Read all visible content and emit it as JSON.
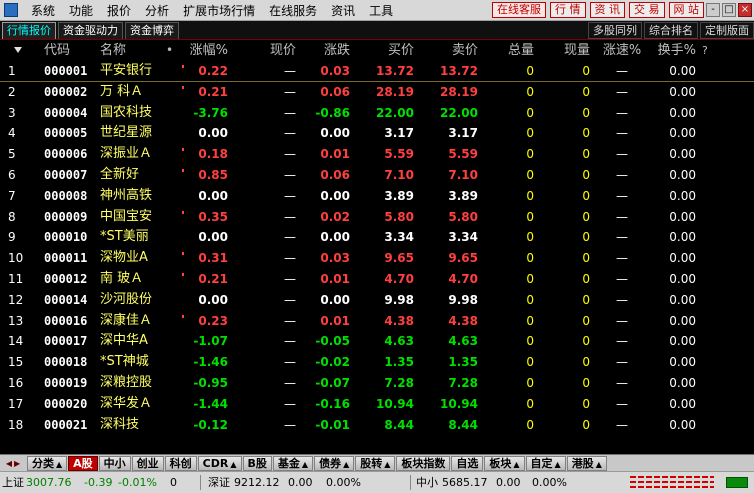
{
  "menu": {
    "items": [
      "系统",
      "功能",
      "报价",
      "分析",
      "扩展市场行情",
      "在线服务",
      "资讯",
      "工具"
    ],
    "buttons": [
      "在线客服",
      "行 情",
      "资 讯",
      "交 易",
      "网 站"
    ],
    "window_controls": [
      "-",
      "□",
      "×"
    ]
  },
  "subtabs": {
    "left": [
      "行情报价",
      "资金驱动力",
      "资金博弈"
    ],
    "right": [
      "多股同列",
      "综合排名",
      "定制版面"
    ]
  },
  "table": {
    "headers": {
      "code": "代码",
      "name": "名称",
      "dot": "•",
      "chg_pct": "涨幅%",
      "price": "现价",
      "diff": "涨跌",
      "buy": "买价",
      "sell": "卖价",
      "volume": "总量",
      "cur_vol": "现量",
      "speed": "涨速%",
      "turnover": "换手%",
      "help": "?"
    },
    "rows": [
      {
        "idx": "1",
        "code": "000001",
        "name": "平安银行",
        "chg": "0.22",
        "price": "—",
        "diff": "0.03",
        "buy": "13.72",
        "sell": "13.72",
        "vol": "0",
        "cur": "0",
        "spd": "—",
        "turn": "0.00",
        "dir": "up"
      },
      {
        "idx": "2",
        "code": "000002",
        "name": "万 科Ａ",
        "chg": "0.21",
        "price": "—",
        "diff": "0.06",
        "buy": "28.19",
        "sell": "28.19",
        "vol": "0",
        "cur": "0",
        "spd": "—",
        "turn": "0.00",
        "dir": "up"
      },
      {
        "idx": "3",
        "code": "000004",
        "name": "国农科技",
        "chg": "-3.76",
        "price": "—",
        "diff": "-0.86",
        "buy": "22.00",
        "sell": "22.00",
        "vol": "0",
        "cur": "0",
        "spd": "—",
        "turn": "0.00",
        "dir": "down"
      },
      {
        "idx": "4",
        "code": "000005",
        "name": "世纪星源",
        "chg": "0.00",
        "price": "—",
        "diff": "0.00",
        "buy": "3.17",
        "sell": "3.17",
        "vol": "0",
        "cur": "0",
        "spd": "—",
        "turn": "0.00",
        "dir": "flat"
      },
      {
        "idx": "5",
        "code": "000006",
        "name": "深振业Ａ",
        "chg": "0.18",
        "price": "—",
        "diff": "0.01",
        "buy": "5.59",
        "sell": "5.59",
        "vol": "0",
        "cur": "0",
        "spd": "—",
        "turn": "0.00",
        "dir": "up"
      },
      {
        "idx": "6",
        "code": "000007",
        "name": "全新好",
        "chg": "0.85",
        "price": "—",
        "diff": "0.06",
        "buy": "7.10",
        "sell": "7.10",
        "vol": "0",
        "cur": "0",
        "spd": "—",
        "turn": "0.00",
        "dir": "up"
      },
      {
        "idx": "7",
        "code": "000008",
        "name": "神州高铁",
        "chg": "0.00",
        "price": "—",
        "diff": "0.00",
        "buy": "3.89",
        "sell": "3.89",
        "vol": "0",
        "cur": "0",
        "spd": "—",
        "turn": "0.00",
        "dir": "flat"
      },
      {
        "idx": "8",
        "code": "000009",
        "name": "中国宝安",
        "chg": "0.35",
        "price": "—",
        "diff": "0.02",
        "buy": "5.80",
        "sell": "5.80",
        "vol": "0",
        "cur": "0",
        "spd": "—",
        "turn": "0.00",
        "dir": "up"
      },
      {
        "idx": "9",
        "code": "000010",
        "name": "*ST美丽",
        "chg": "0.00",
        "price": "—",
        "diff": "0.00",
        "buy": "3.34",
        "sell": "3.34",
        "vol": "0",
        "cur": "0",
        "spd": "—",
        "turn": "0.00",
        "dir": "flat"
      },
      {
        "idx": "10",
        "code": "000011",
        "name": "深物业A",
        "chg": "0.31",
        "price": "—",
        "diff": "0.03",
        "buy": "9.65",
        "sell": "9.65",
        "vol": "0",
        "cur": "0",
        "spd": "—",
        "turn": "0.00",
        "dir": "up"
      },
      {
        "idx": "11",
        "code": "000012",
        "name": "南 玻Ａ",
        "chg": "0.21",
        "price": "—",
        "diff": "0.01",
        "buy": "4.70",
        "sell": "4.70",
        "vol": "0",
        "cur": "0",
        "spd": "—",
        "turn": "0.00",
        "dir": "up"
      },
      {
        "idx": "12",
        "code": "000014",
        "name": "沙河股份",
        "chg": "0.00",
        "price": "—",
        "diff": "0.00",
        "buy": "9.98",
        "sell": "9.98",
        "vol": "0",
        "cur": "0",
        "spd": "—",
        "turn": "0.00",
        "dir": "flat"
      },
      {
        "idx": "13",
        "code": "000016",
        "name": "深康佳Ａ",
        "chg": "0.23",
        "price": "—",
        "diff": "0.01",
        "buy": "4.38",
        "sell": "4.38",
        "vol": "0",
        "cur": "0",
        "spd": "—",
        "turn": "0.00",
        "dir": "up"
      },
      {
        "idx": "14",
        "code": "000017",
        "name": "深中华A",
        "chg": "-1.07",
        "price": "—",
        "diff": "-0.05",
        "buy": "4.63",
        "sell": "4.63",
        "vol": "0",
        "cur": "0",
        "spd": "—",
        "turn": "0.00",
        "dir": "down"
      },
      {
        "idx": "15",
        "code": "000018",
        "name": "*ST神城",
        "chg": "-1.46",
        "price": "—",
        "diff": "-0.02",
        "buy": "1.35",
        "sell": "1.35",
        "vol": "0",
        "cur": "0",
        "spd": "—",
        "turn": "0.00",
        "dir": "down"
      },
      {
        "idx": "16",
        "code": "000019",
        "name": "深粮控股",
        "chg": "-0.95",
        "price": "—",
        "diff": "-0.07",
        "buy": "7.28",
        "sell": "7.28",
        "vol": "0",
        "cur": "0",
        "spd": "—",
        "turn": "0.00",
        "dir": "down"
      },
      {
        "idx": "17",
        "code": "000020",
        "name": "深华发Ａ",
        "chg": "-1.44",
        "price": "—",
        "diff": "-0.16",
        "buy": "10.94",
        "sell": "10.94",
        "vol": "0",
        "cur": "0",
        "spd": "—",
        "turn": "0.00",
        "dir": "down"
      },
      {
        "idx": "18",
        "code": "000021",
        "name": "深科技",
        "chg": "-0.12",
        "price": "—",
        "diff": "-0.01",
        "buy": "8.44",
        "sell": "8.44",
        "vol": "0",
        "cur": "0",
        "spd": "—",
        "turn": "0.00",
        "dir": "down"
      }
    ]
  },
  "category_tabs": [
    {
      "label": "分类",
      "caret": true,
      "active": false
    },
    {
      "label": "A股",
      "caret": false,
      "active": true
    },
    {
      "label": "中小",
      "caret": false,
      "active": false
    },
    {
      "label": "创业",
      "caret": false,
      "active": false
    },
    {
      "label": "科创",
      "caret": false,
      "active": false
    },
    {
      "label": "CDR",
      "caret": true,
      "active": false
    },
    {
      "label": "B股",
      "caret": false,
      "active": false
    },
    {
      "label": "基金",
      "caret": true,
      "active": false
    },
    {
      "label": "债券",
      "caret": true,
      "active": false
    },
    {
      "label": "股转",
      "caret": true,
      "active": false
    },
    {
      "label": "板块指数",
      "caret": false,
      "active": false
    },
    {
      "label": "自选",
      "caret": false,
      "active": false
    },
    {
      "label": "板块",
      "caret": true,
      "active": false
    },
    {
      "label": "自定",
      "caret": true,
      "active": false
    },
    {
      "label": "港股",
      "caret": true,
      "active": false
    }
  ],
  "status": {
    "sh_label": "上证",
    "sh_value": "3007.76",
    "sh_change": "-0.39",
    "sh_pct": "-0.01%",
    "sh_vol": "0",
    "sz_label": "深证",
    "sz_value": "9212.12",
    "sz_change": "0.00",
    "sz_pct": "0.00%",
    "zx_label": "中小",
    "zx_value": "5685.17",
    "zx_change": "0.00",
    "zx_pct": "0.00%"
  },
  "colors": {
    "up": "#ff4040",
    "down": "#00e000",
    "flat": "#ffffff",
    "name": "#ffff66",
    "volume": "#ffff00",
    "active_tab": "#c00000"
  }
}
